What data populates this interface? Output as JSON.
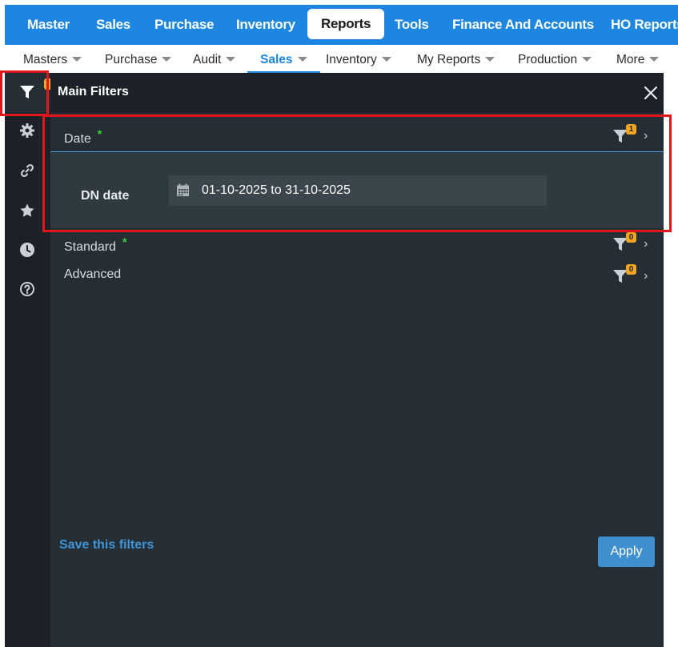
{
  "top_nav": {
    "items": [
      "Master",
      "Sales",
      "Purchase",
      "Inventory",
      "Reports",
      "Tools",
      "Finance And Accounts",
      "HO Reports"
    ],
    "active": "Reports",
    "color": "#1c86e0"
  },
  "sub_nav": {
    "items": [
      "Masters",
      "Purchase",
      "Audit",
      "Sales",
      "Inventory",
      "My Reports",
      "Production",
      "More"
    ],
    "active": "Sales"
  },
  "sidebar": {
    "icons": [
      "filter-icon",
      "gear-icon",
      "link-icon",
      "star-icon",
      "clock-icon",
      "help-icon"
    ]
  },
  "panel": {
    "title": "Main Filters",
    "sections": [
      {
        "label": "Date",
        "required_mark": "*",
        "count": "1"
      },
      {
        "label": "Standard",
        "required_mark": "*",
        "count": "0"
      },
      {
        "label": "Advanced",
        "required_mark": "",
        "count": "0"
      }
    ],
    "date_field": {
      "label": "DN date",
      "value": "01-10-2025 to 31-10-2025"
    },
    "save_link": "Save this filters",
    "apply_label": "Apply"
  },
  "colors": {
    "badge": "#f5a623",
    "required_star": "#3cd13c",
    "annotation": "#e0161c"
  }
}
